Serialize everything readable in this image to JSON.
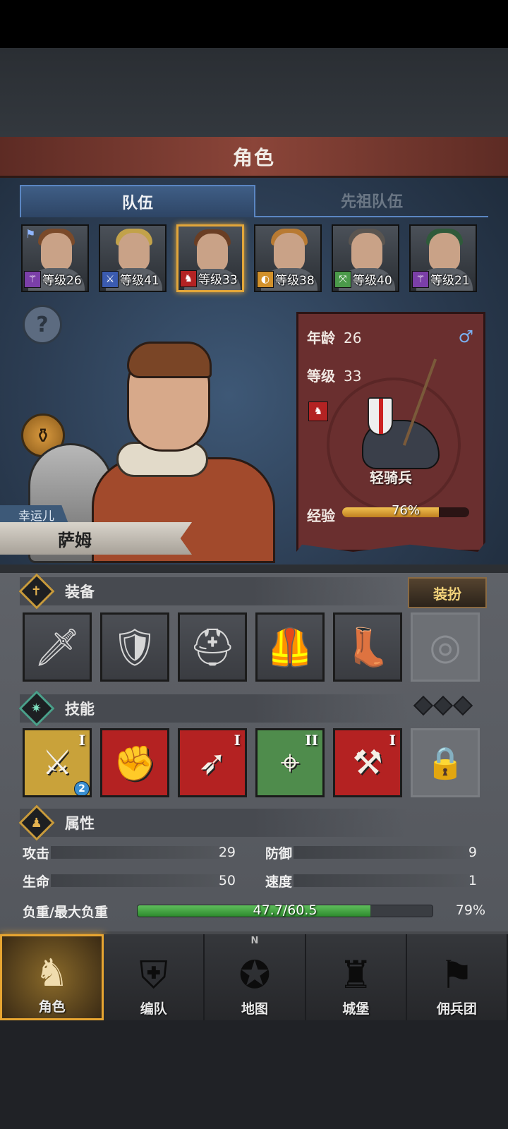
{
  "header": {
    "title": "角色"
  },
  "tabs": [
    {
      "label": "队伍",
      "active": true
    },
    {
      "label": "先祖队伍",
      "active": false
    }
  ],
  "roster": [
    {
      "level_text": "等级26",
      "class_icon": "staff-icon",
      "class_color": "#7b3fa8",
      "hair": "#7a4a2a",
      "flag": true
    },
    {
      "level_text": "等级41",
      "class_icon": "sword-icon",
      "class_color": "#3b5bb0",
      "hair": "#c2a24a",
      "flag": false
    },
    {
      "level_text": "等级33",
      "class_icon": "horse-icon",
      "class_color": "#b32323",
      "hair": "#6a3e24",
      "flag": false,
      "selected": true
    },
    {
      "level_text": "等级38",
      "class_icon": "shield-icon",
      "class_color": "#d2912a",
      "hair": "#b87a32",
      "flag": false
    },
    {
      "level_text": "等级40",
      "class_icon": "bow-icon",
      "class_color": "#4b9a4a",
      "hair": "#5a5550",
      "flag": false
    },
    {
      "level_text": "等级21",
      "class_icon": "staff-icon",
      "class_color": "#7b3fa8",
      "hair": "#2f5a3a",
      "flag": false
    }
  ],
  "character": {
    "trait": "幸运儿",
    "name": "萨姆",
    "age_label": "年龄",
    "age": "26",
    "level_label": "等级",
    "level": "33",
    "gender_symbol": "♂",
    "class_icon": "horse-icon",
    "class_name": "轻骑兵",
    "exp_label": "经验",
    "exp_text": "76%",
    "exp_progress": 0.76
  },
  "equipment": {
    "title": "装备",
    "dress_button": "装扮",
    "slots": [
      {
        "icon": "sword-icon",
        "glyph": "🗡"
      },
      {
        "icon": "shield-icon",
        "glyph": "🛡"
      },
      {
        "icon": "helmet-icon",
        "glyph": "⛑"
      },
      {
        "icon": "chest-armor-icon",
        "glyph": "🦺"
      },
      {
        "icon": "boots-icon",
        "glyph": "👢"
      },
      {
        "icon": "ring-icon",
        "glyph": "◎",
        "empty": true
      }
    ]
  },
  "skills": {
    "title": "技能",
    "slots": [
      {
        "icon": "sword-strike-skill-icon",
        "glyph": "⚔",
        "rank": "I",
        "bg": "#c9a23a",
        "badge": "2"
      },
      {
        "icon": "shield-bash-skill-icon",
        "glyph": "✊",
        "rank": "",
        "bg": "#b42222"
      },
      {
        "icon": "shield-charge-skill-icon",
        "glyph": "➶",
        "rank": "I",
        "bg": "#b42222"
      },
      {
        "icon": "target-skill-icon",
        "glyph": "⌖",
        "rank": "II",
        "bg": "#4f8c4c"
      },
      {
        "icon": "strength-skill-icon",
        "glyph": "⚒",
        "rank": "I",
        "bg": "#b42222"
      },
      {
        "icon": "lock-icon",
        "glyph": "🔒",
        "rank": "",
        "bg": "#6d7075",
        "locked": true
      }
    ]
  },
  "attributes": {
    "title": "属性",
    "attack_label": "攻击",
    "attack": "29",
    "defense_label": "防御",
    "defense": "9",
    "health_label": "生命",
    "health": "50",
    "speed_label": "速度",
    "speed": "1",
    "weight_label": "负重/最大负重",
    "weight_text": "47.7/60.5",
    "weight_pct": "79%",
    "weight_progress": 0.79
  },
  "nav": {
    "compass_letter": "N",
    "items": [
      {
        "label": "角色",
        "icon": "knight-icon",
        "active": true
      },
      {
        "label": "编队",
        "icon": "formation-icon",
        "active": false
      },
      {
        "label": "地图",
        "icon": "map-compass-icon",
        "active": false
      },
      {
        "label": "城堡",
        "icon": "castle-icon",
        "active": false
      },
      {
        "label": "佣兵团",
        "icon": "mercenary-icon",
        "active": false
      }
    ]
  }
}
